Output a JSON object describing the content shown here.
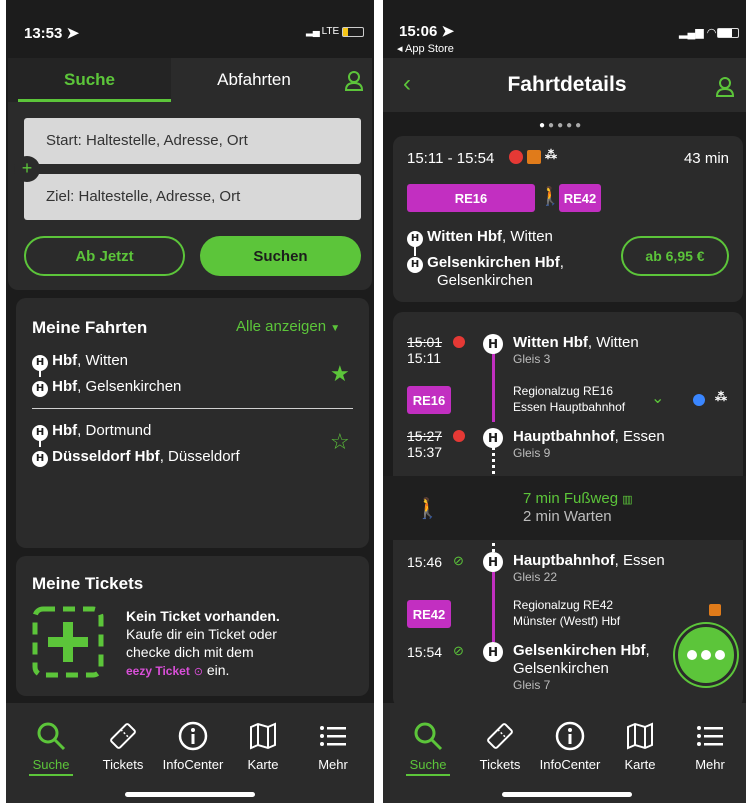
{
  "left": {
    "status": {
      "time": "13:53",
      "network": "LTE"
    },
    "tabs": {
      "search": "Suche",
      "departures": "Abfahrten"
    },
    "form": {
      "start_placeholder": "Start: Haltestelle, Adresse, Ort",
      "dest_placeholder": "Ziel: Haltestelle, Adresse, Ort",
      "now_button": "Ab Jetzt",
      "search_button": "Suchen"
    },
    "my_trips": {
      "title": "Meine Fahrten",
      "show_all": "Alle anzeigen",
      "trips": [
        {
          "from_bold": "Hbf",
          "from_rest": ", Witten",
          "to_bold": "Hbf",
          "to_rest": ", Gelsenkirchen",
          "starred": true
        },
        {
          "from_bold": "Hbf",
          "from_rest": ", Dortmund",
          "to_bold": "Düsseldorf Hbf",
          "to_rest": ", Düsseldorf",
          "starred": false
        }
      ]
    },
    "my_tickets": {
      "title": "Meine Tickets",
      "empty_title": "Kein Ticket vorhanden.",
      "line1": "Kaufe dir ein Ticket oder",
      "line2": "checke dich mit dem",
      "link": "eezy Ticket",
      "suffix": "ein."
    }
  },
  "right": {
    "status": {
      "time": "15:06",
      "back_app": "App Store"
    },
    "header": {
      "title": "Fahrtdetails"
    },
    "summary": {
      "time_range": "15:11 - 15:54",
      "duration": "43 min",
      "line_a": "RE16",
      "line_b": "RE42",
      "origin_bold": "Witten Hbf",
      "origin_rest": ", Witten",
      "dest_bold": "Gelsenkirchen Hbf",
      "dest_rest": ",",
      "dest_line2": "Gelsenkirchen",
      "price": "ab 6,95 €"
    },
    "stops": [
      {
        "planned": "15:01",
        "actual": "15:11",
        "name_bold": "Witten Hbf",
        "name_rest": ", Witten",
        "platform": "Gleis 3"
      },
      {
        "planned": "15:27",
        "actual": "15:37",
        "name_bold": "Hauptbahnhof",
        "name_rest": ", Essen",
        "platform": "Gleis 9"
      },
      {
        "time": "15:46",
        "name_bold": "Hauptbahnhof",
        "name_rest": ", Essen",
        "platform": "Gleis 22"
      },
      {
        "time": "15:54",
        "name_bold": "Gelsenkirchen Hbf",
        "name_rest": ",",
        "name_line2": "Gelsenkirchen",
        "platform": "Gleis 7"
      }
    ],
    "legs": [
      {
        "line": "RE16",
        "name": "Regionalzug RE16",
        "direction": "Essen Hauptbahnhof"
      },
      {
        "line": "RE42",
        "name": "Regionalzug RE42",
        "direction": "Münster (Westf) Hbf"
      }
    ],
    "walk": {
      "title": "7 min Fußweg",
      "wait": "2 min Warten"
    }
  },
  "tabbar": {
    "items": [
      {
        "label": "Suche",
        "icon": "search-icon"
      },
      {
        "label": "Tickets",
        "icon": "ticket-icon"
      },
      {
        "label": "InfoCenter",
        "icon": "info-icon"
      },
      {
        "label": "Karte",
        "icon": "map-icon"
      },
      {
        "label": "Mehr",
        "icon": "menu-icon"
      }
    ]
  },
  "colors": {
    "accent": "#5cc53a",
    "line": "#c22fc1",
    "background": "#1c1c1c",
    "card": "#2b2b2b",
    "delay": "#e53935"
  }
}
